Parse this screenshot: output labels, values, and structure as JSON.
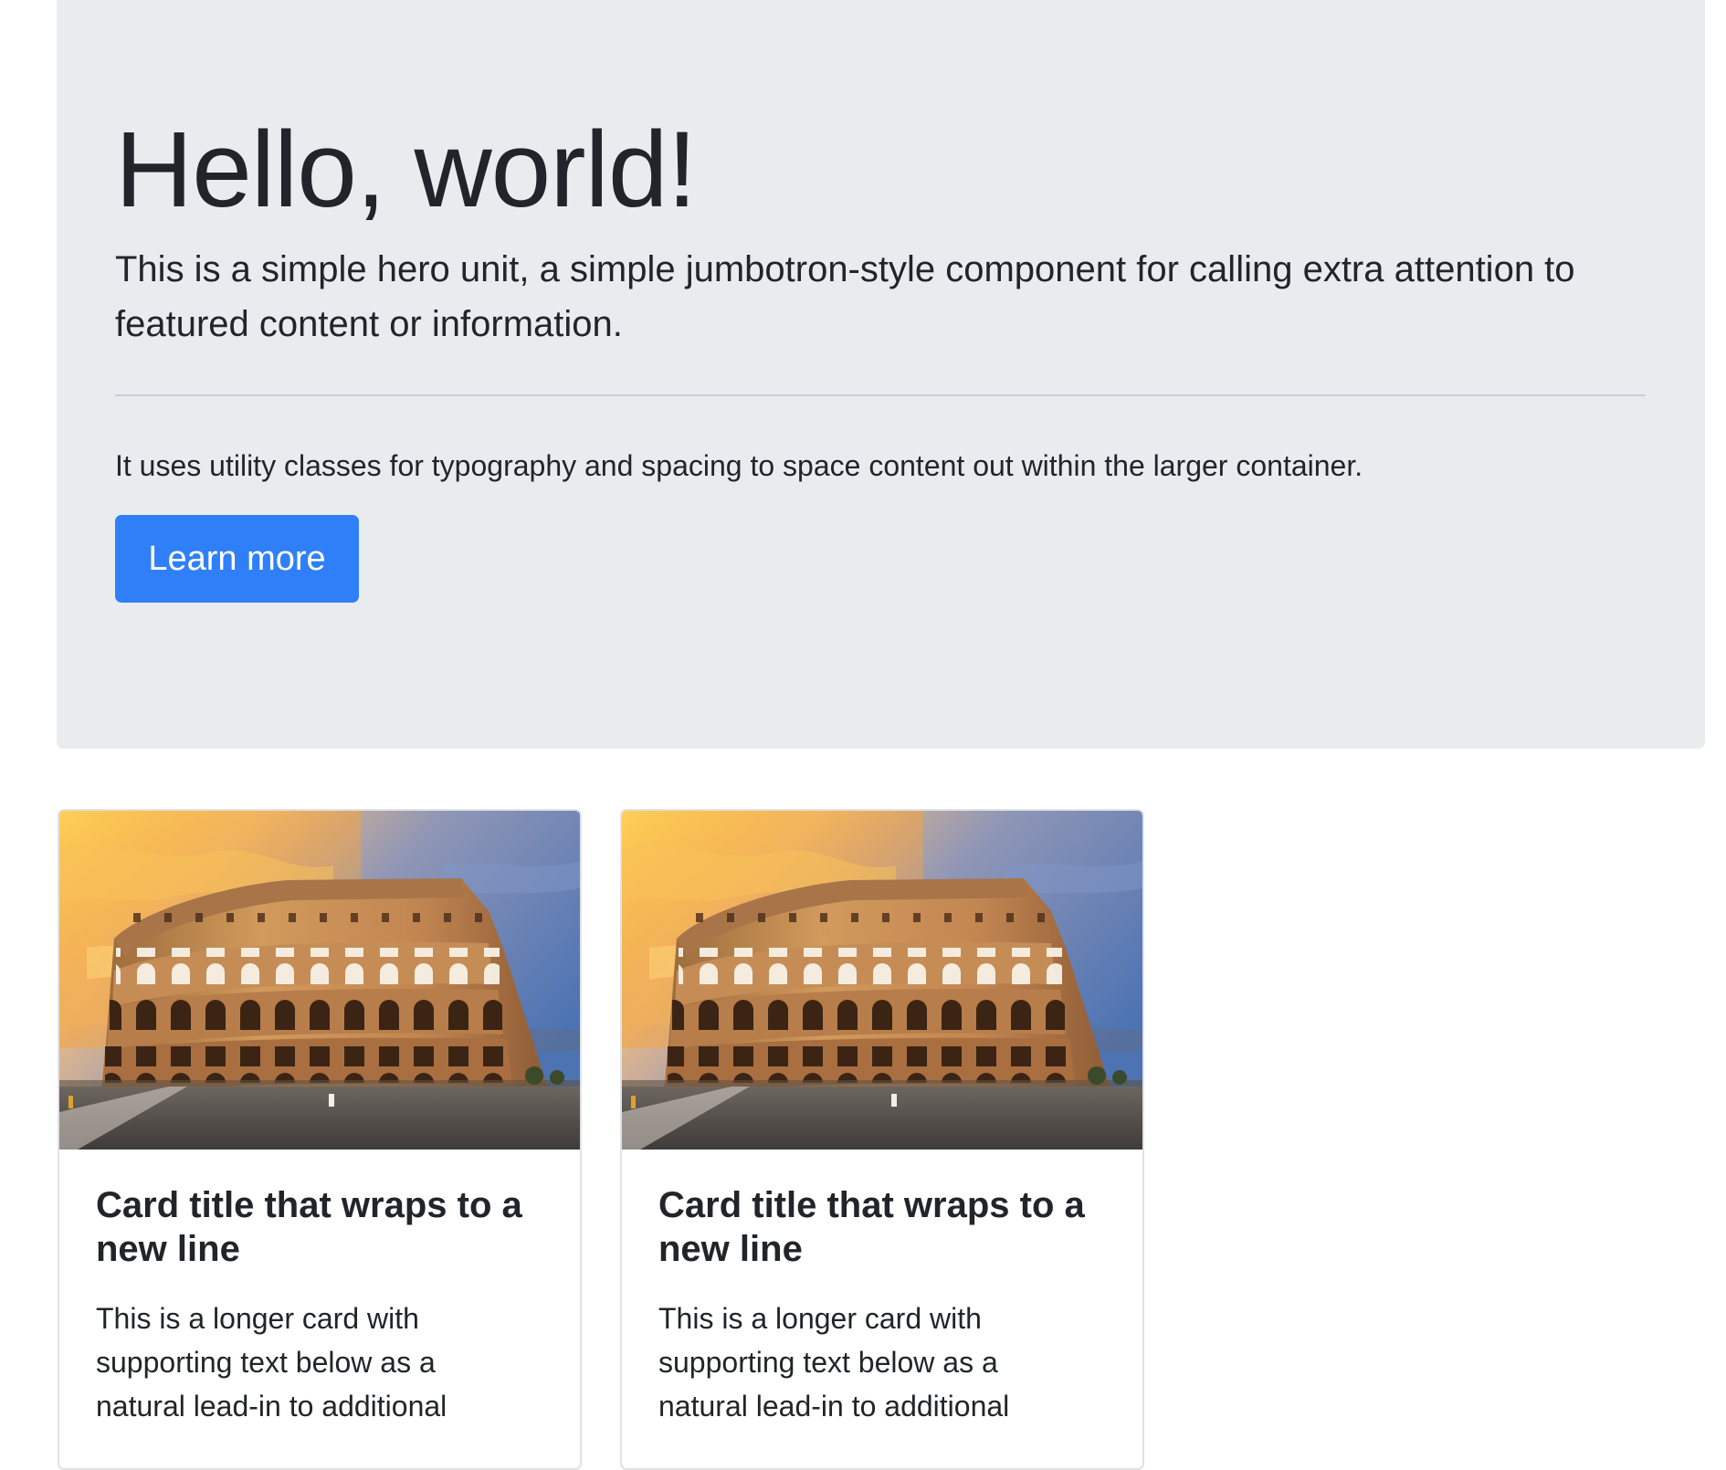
{
  "hero": {
    "title": "Hello, world!",
    "lead": "This is a simple hero unit, a simple jumbotron-style component for calling extra attention to featured content or information.",
    "body": "It uses utility classes for typography and spacing to space content out within the larger container.",
    "button_label": "Learn more"
  },
  "cards": [
    {
      "image": "colosseum-photo",
      "title": "Card title that wraps to a new line",
      "text": "This is a longer card with supporting text below as a natural lead-in to additional"
    },
    {
      "image": "colosseum-photo",
      "title": "Card title that wraps to a new line",
      "text": "This is a longer card with supporting text below as a natural lead-in to additional"
    }
  ],
  "colors": {
    "jumbotron_bg": "#e9ecef",
    "primary": "#2f80f8",
    "text": "#212529",
    "card_border": "#dfe2e6"
  }
}
